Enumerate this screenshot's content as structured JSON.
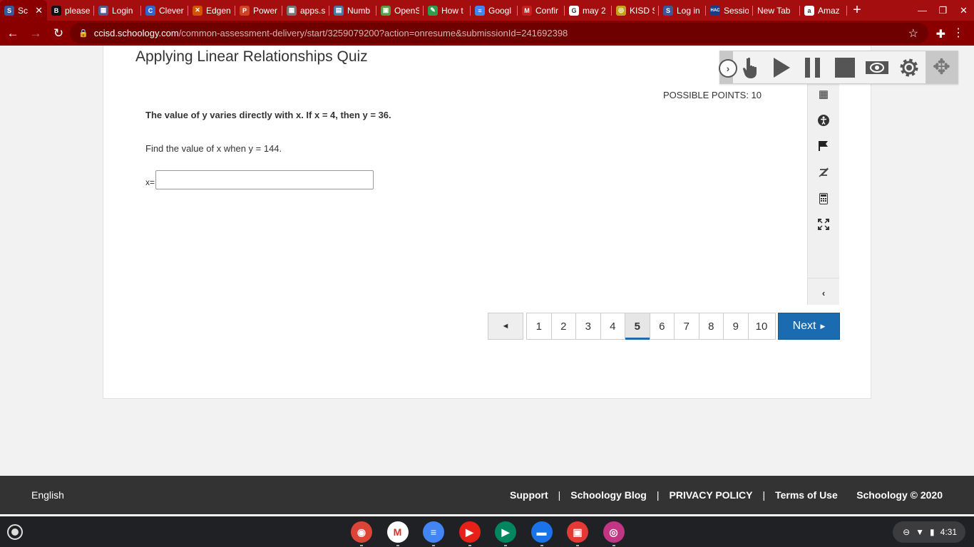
{
  "browser": {
    "tabs": [
      {
        "label": "Sc",
        "fav": "S",
        "color": "#3b5998"
      },
      {
        "label": "please",
        "fav": "B",
        "color": "#111111"
      },
      {
        "label": "Login",
        "fav": "▦",
        "color": "#5a5a8a"
      },
      {
        "label": "Clever",
        "fav": "C",
        "color": "#3366cc"
      },
      {
        "label": "Edgen",
        "fav": "✕",
        "color": "#d35400"
      },
      {
        "label": "Power",
        "fav": "P",
        "color": "#d04423"
      },
      {
        "label": "apps.s",
        "fav": "▦",
        "color": "#777777"
      },
      {
        "label": "Numb",
        "fav": "▤",
        "color": "#4a7aa8"
      },
      {
        "label": "OpenS",
        "fav": "▣",
        "color": "#5a9e4a"
      },
      {
        "label": "How t",
        "fav": "✎",
        "color": "#2e9e4a"
      },
      {
        "label": "Googl",
        "fav": "≡",
        "color": "#4285f4"
      },
      {
        "label": "Confir",
        "fav": "M",
        "color": "#c5221f"
      },
      {
        "label": "may 2",
        "fav": "G",
        "color": "#ffffff"
      },
      {
        "label": "KISD S",
        "fav": "◎",
        "color": "#c8a020"
      },
      {
        "label": "Log in",
        "fav": "S",
        "color": "#3b5998"
      },
      {
        "label": "Sessio",
        "fav": "HAC",
        "color": "#1a3a8a"
      },
      {
        "label": "New Tab",
        "fav": "",
        "color": ""
      },
      {
        "label": "Amaz",
        "fav": "a",
        "color": "#ffffff"
      }
    ],
    "url_host": "ccisd.schoology.com",
    "url_path": "/common-assessment-delivery/start/3259079200?action=onresume&submissionId=241692398"
  },
  "quiz": {
    "title": "Applying Linear Relationships Quiz",
    "points": "POSSIBLE POINTS: 10",
    "question_bold": "The value of y varies directly with x. If x = 4, then y = 36.",
    "question_text": "Find the value of x when y = 144.",
    "answer_label": "x=",
    "answer_value": ""
  },
  "pagination": {
    "prev_label": "◄",
    "pages": [
      "1",
      "2",
      "3",
      "4",
      "5",
      "6",
      "7",
      "8",
      "9",
      "10"
    ],
    "current": "5",
    "next_label": "Next"
  },
  "footer": {
    "language": "English",
    "links": [
      "Support",
      "Schoology Blog",
      "PRIVACY POLICY",
      "Terms of Use"
    ],
    "separator": "|",
    "copyright": "Schoology © 2020"
  },
  "shelf": {
    "apps": [
      {
        "name": "chrome-icon",
        "color": "#db4437",
        "glyph": "◉"
      },
      {
        "name": "gmail-icon",
        "color": "#ffffff",
        "glyph": "M"
      },
      {
        "name": "docs-icon",
        "color": "#4285f4",
        "glyph": "≡"
      },
      {
        "name": "youtube-icon",
        "color": "#e62117",
        "glyph": "▶"
      },
      {
        "name": "play-store-icon",
        "color": "#01875f",
        "glyph": "▶"
      },
      {
        "name": "files-icon",
        "color": "#1a73e8",
        "glyph": "▬"
      },
      {
        "name": "gallery-icon",
        "color": "#e53935",
        "glyph": "▣"
      },
      {
        "name": "instagram-icon",
        "color": "#c13584",
        "glyph": "◎"
      }
    ],
    "time": "4:31"
  }
}
